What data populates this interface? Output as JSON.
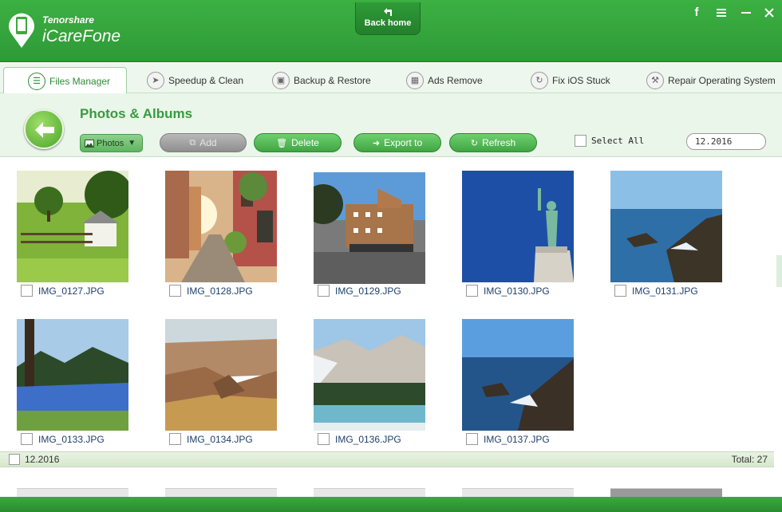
{
  "app": {
    "brand_top": "Tenorshare",
    "brand_name": "iCareFone",
    "back_home_label": "Back home",
    "window_controls": [
      "facebook-icon",
      "menu-icon",
      "minimize-icon",
      "close-icon"
    ]
  },
  "tabs": [
    {
      "label": "Files Manager",
      "icon": "files-icon",
      "active": true
    },
    {
      "label": "Speedup & Clean",
      "icon": "rocket-icon",
      "active": false
    },
    {
      "label": "Backup & Restore",
      "icon": "folder-icon",
      "active": false
    },
    {
      "label": "Ads Remove",
      "icon": "trash-icon",
      "active": false
    },
    {
      "label": "Fix iOS Stuck",
      "icon": "refresh-icon",
      "active": false
    },
    {
      "label": "Repair Operating System",
      "icon": "wrench-icon",
      "active": false
    }
  ],
  "header": {
    "title": "Photos & Albums",
    "category_select": "Photos",
    "buttons": {
      "add": "Add",
      "delete": "Delete",
      "export": "Export to",
      "refresh": "Refresh"
    },
    "select_all_label": "Select All",
    "date_value": "12.2016"
  },
  "photos": [
    {
      "name": "IMG_0127.JPG",
      "scene": "farm"
    },
    {
      "name": "IMG_0128.JPG",
      "scene": "street"
    },
    {
      "name": "IMG_0129.JPG",
      "scene": "hotel"
    },
    {
      "name": "IMG_0130.JPG",
      "scene": "liberty"
    },
    {
      "name": "IMG_0131.JPG",
      "scene": "coast"
    },
    {
      "name": "IMG_0133.JPG",
      "scene": "river"
    },
    {
      "name": "IMG_0134.JPG",
      "scene": "canyon"
    },
    {
      "name": "IMG_0136.JPG",
      "scene": "glacier"
    },
    {
      "name": "IMG_0137.JPG",
      "scene": "coast2"
    }
  ],
  "group": {
    "date": "12.2016",
    "total": "Total:  27"
  },
  "colors": {
    "brand_green": "#35a43c",
    "title_green": "#3a9a3f",
    "header_bg": "#eaf6ea"
  }
}
